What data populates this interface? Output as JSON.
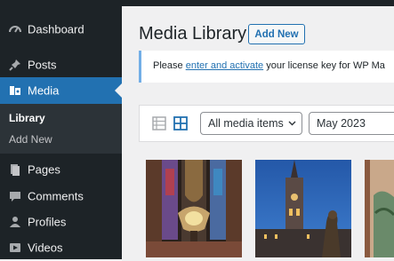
{
  "sidebar": {
    "items": [
      {
        "label": "Dashboard",
        "icon": "dashboard-icon"
      },
      {
        "label": "Posts",
        "icon": "pin-icon"
      },
      {
        "label": "Media",
        "icon": "media-icon",
        "active": true
      },
      {
        "label": "Pages",
        "icon": "pages-icon"
      },
      {
        "label": "Comments",
        "icon": "comments-icon"
      },
      {
        "label": "Profiles",
        "icon": "profiles-icon"
      },
      {
        "label": "Videos",
        "icon": "videos-icon"
      }
    ],
    "submenu": [
      {
        "label": "Library",
        "current": true
      },
      {
        "label": "Add New"
      }
    ]
  },
  "header": {
    "title": "Media Library",
    "add_new_label": "Add New"
  },
  "notice": {
    "prefix": "Please ",
    "link_text": "enter and activate",
    "suffix": " your license key for WP Ma"
  },
  "filters": {
    "view_list_icon": "list-view-icon",
    "view_grid_icon": "grid-view-icon",
    "type_filter": "All media items",
    "date_filter": "May 2023"
  },
  "colors": {
    "sidebar_bg": "#1d2327",
    "accent": "#2271b1",
    "notice_border": "#72aee6"
  },
  "thumbnails": [
    {
      "icon": "photo-thumbnail"
    },
    {
      "icon": "photo-thumbnail"
    },
    {
      "icon": "photo-thumbnail"
    }
  ]
}
